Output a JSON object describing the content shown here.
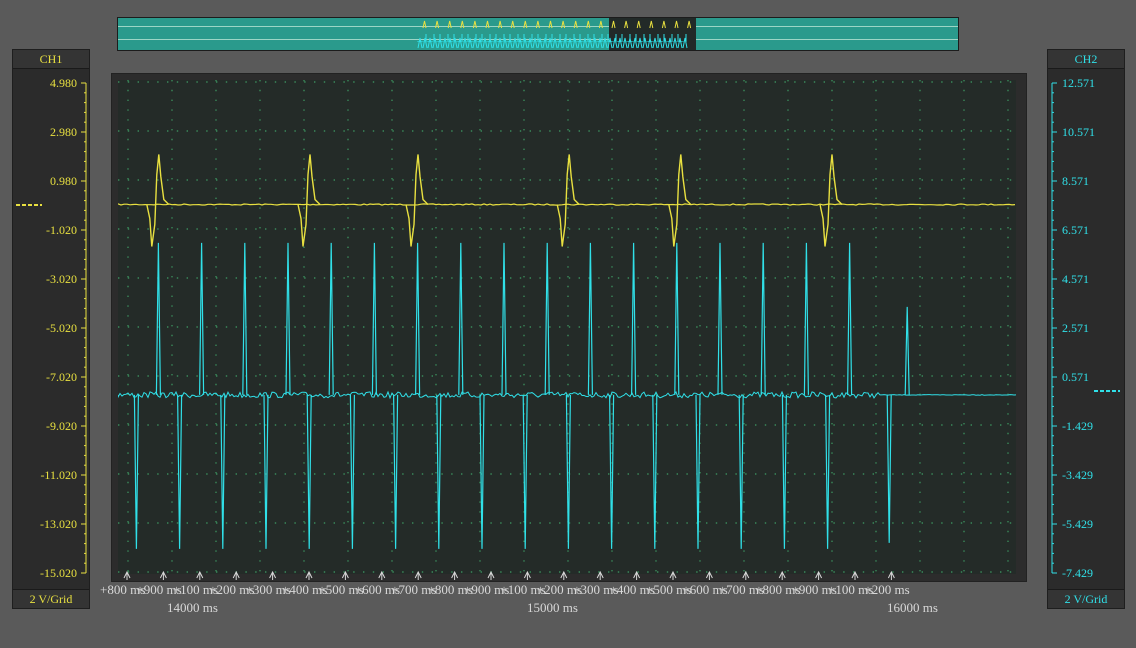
{
  "colors": {
    "ch1": "#e8e040",
    "ch2": "#30e0e8",
    "grid": "#3a8a5a",
    "plot_bg": "#242b28"
  },
  "ch1": {
    "title": "CH1",
    "scale": "2 V/Grid",
    "ticks": [
      "4.980",
      "2.980",
      "0.980",
      "-1.020",
      "-3.020",
      "-5.020",
      "-7.020",
      "-9.020",
      "-11.020",
      "-13.020",
      "-15.020"
    ]
  },
  "ch2": {
    "title": "CH2",
    "scale": "2 V/Grid",
    "ticks": [
      "12.571",
      "10.571",
      "8.571",
      "6.571",
      "4.571",
      "2.571",
      "0.571",
      "-1.429",
      "-3.429",
      "-5.429",
      "-7.429"
    ]
  },
  "x_axis": {
    "minor_labels": [
      "+800 ms",
      "+900 ms",
      "+100 ms",
      "+200 ms",
      "+300 ms",
      "+400 ms",
      "+500 ms",
      "+600 ms",
      "+700 ms",
      "+800 ms",
      "+900 ms",
      "+100 ms",
      "+200 ms",
      "+300 ms",
      "+400 ms",
      "+500 ms",
      "+600 ms",
      "+700 ms",
      "+800 ms",
      "+900 ms",
      "+100 ms",
      "+200 ms"
    ],
    "major_labels": [
      "14000 ms",
      "15000 ms",
      "16000 ms"
    ]
  },
  "chart_data": {
    "type": "line",
    "title": "",
    "x_unit": "ms",
    "ylim_ch1": [
      -15.02,
      4.98
    ],
    "ylim_ch2": [
      -7.429,
      12.571
    ],
    "series": [
      {
        "name": "CH1",
        "baseline": -0.02,
        "spike_times_ms": [
          13880,
          14300,
          14600,
          15020,
          15330,
          15750
        ]
      },
      {
        "name": "CH2",
        "baseline": -0.2,
        "spike_times_ms": [
          13890,
          14010,
          14130,
          14250,
          14370,
          14490,
          14610,
          14730,
          14850,
          14970,
          15090,
          15210,
          15330,
          15450,
          15570,
          15690,
          15810,
          15970
        ]
      }
    ]
  }
}
